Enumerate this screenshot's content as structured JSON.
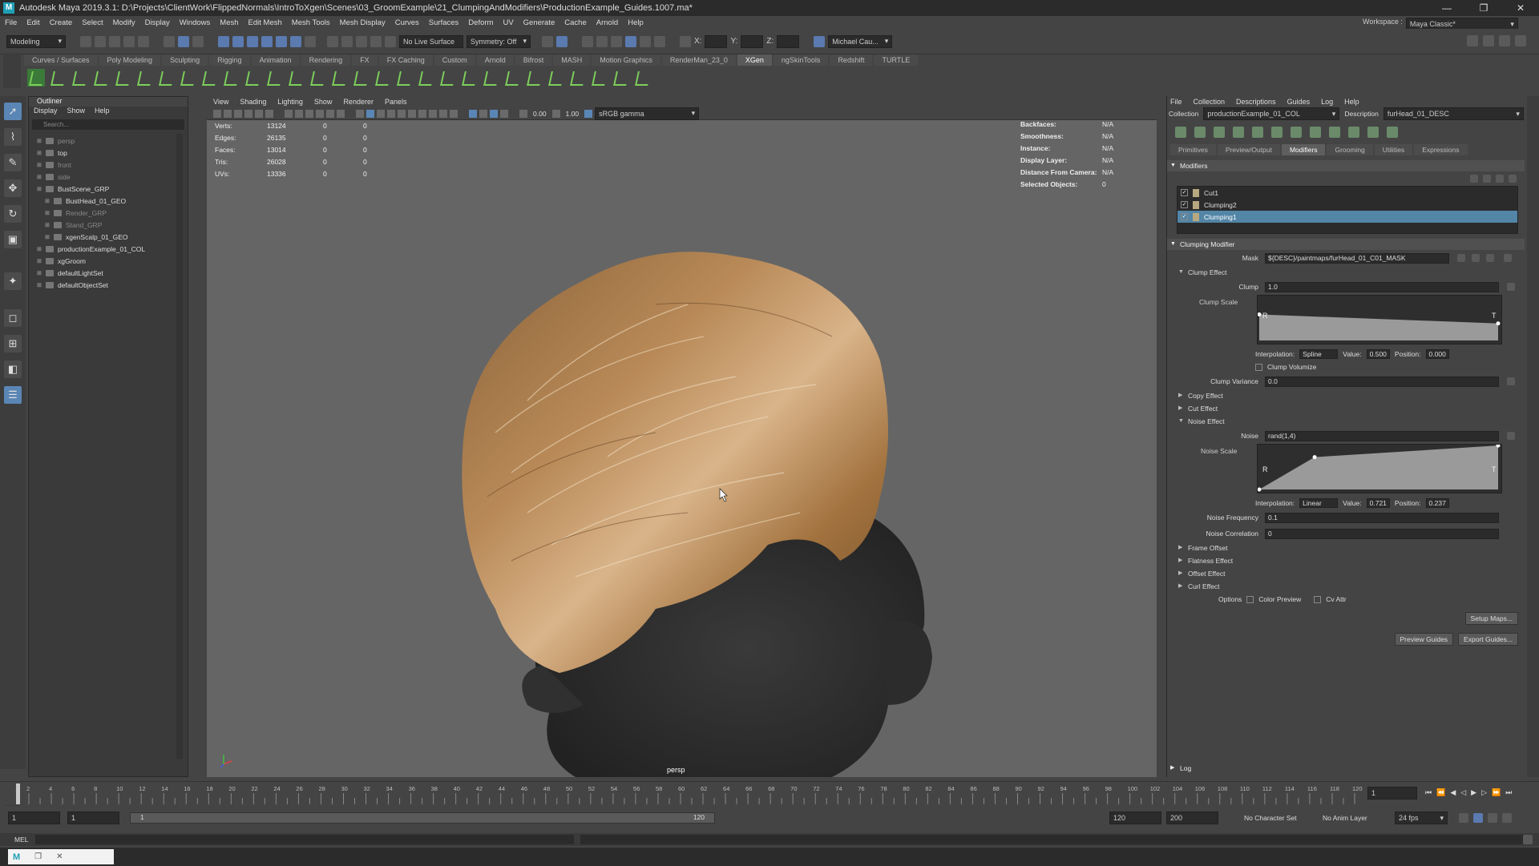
{
  "title_bar": {
    "title": "Autodesk Maya 2019.3.1: D:\\Projects\\ClientWork\\FlippedNormals\\IntroToXgen\\Scenes\\03_GroomExample\\21_ClumpingAndModifiers\\ProductionExample_Guides.1007.ma*",
    "minimize": "—",
    "maximize": "❐",
    "close": "✕"
  },
  "menu_bar": [
    "File",
    "Edit",
    "Create",
    "Select",
    "Modify",
    "Display",
    "Windows",
    "Mesh",
    "Edit Mesh",
    "Mesh Tools",
    "Mesh Display",
    "Curves",
    "Surfaces",
    "Deform",
    "UV",
    "Generate",
    "Cache",
    "Arnold",
    "Help"
  ],
  "workspace": {
    "label": "Workspace :",
    "value": "Maya Classic*"
  },
  "status_line": {
    "mode": "Modeling",
    "live_surface": "No Live Surface",
    "symmetry": "Symmetry: Off",
    "x": "X:",
    "y": "Y:",
    "z": "Z:",
    "user": "Michael Cau..."
  },
  "shelf_tabs": [
    "Curves / Surfaces",
    "Poly Modeling",
    "Sculpting",
    "Rigging",
    "Animation",
    "Rendering",
    "FX",
    "FX Caching",
    "Custom",
    "Arnold",
    "Bifrost",
    "MASH",
    "Motion Graphics",
    "RenderMan_23_0",
    "XGen",
    "ngSkinTools",
    "Redshift",
    "TURTLE"
  ],
  "shelf_active": "XGen",
  "outliner": {
    "title": "Outliner",
    "menu": [
      "Display",
      "Show",
      "Help"
    ],
    "search_placeholder": "Search...",
    "items": [
      {
        "label": "persp",
        "dim": true,
        "indent": 1
      },
      {
        "label": "top",
        "dim": false,
        "indent": 1
      },
      {
        "label": "front",
        "dim": true,
        "indent": 1
      },
      {
        "label": "side",
        "dim": true,
        "indent": 1
      },
      {
        "label": "BustScene_GRP",
        "dim": false,
        "indent": 1
      },
      {
        "label": "BustHead_01_GEO",
        "dim": false,
        "indent": 2
      },
      {
        "label": "Render_GRP",
        "dim": true,
        "indent": 2
      },
      {
        "label": "Stand_GRP",
        "dim": true,
        "indent": 2
      },
      {
        "label": "xgenScalp_01_GEO",
        "dim": false,
        "indent": 2
      },
      {
        "label": "productionExample_01_COL",
        "dim": false,
        "indent": 1
      },
      {
        "label": "xgGroom",
        "dim": false,
        "indent": 1
      },
      {
        "label": "defaultLightSet",
        "dim": false,
        "indent": 1
      },
      {
        "label": "defaultObjectSet",
        "dim": false,
        "indent": 1
      }
    ]
  },
  "viewport": {
    "menu": [
      "View",
      "Shading",
      "Lighting",
      "Show",
      "Renderer",
      "Panels"
    ],
    "exposure": "0.00",
    "gamma": "1.00",
    "color_space": "sRGB gamma",
    "camera_label": "persp",
    "hud_left": [
      {
        "k": "Verts:",
        "v1": "13124",
        "v2": "0",
        "v3": "0"
      },
      {
        "k": "Edges:",
        "v1": "26135",
        "v2": "0",
        "v3": "0"
      },
      {
        "k": "Faces:",
        "v1": "13014",
        "v2": "0",
        "v3": "0"
      },
      {
        "k": "Tris:",
        "v1": "26028",
        "v2": "0",
        "v3": "0"
      },
      {
        "k": "UVs:",
        "v1": "13336",
        "v2": "0",
        "v3": "0"
      }
    ],
    "hud_right": [
      {
        "k": "Backfaces:",
        "v": "N/A"
      },
      {
        "k": "Smoothness:",
        "v": "N/A"
      },
      {
        "k": "Instance:",
        "v": "N/A"
      },
      {
        "k": "Display Layer:",
        "v": "N/A"
      },
      {
        "k": "Distance From Camera:",
        "v": "N/A"
      },
      {
        "k": "Selected Objects:",
        "v": "0"
      }
    ]
  },
  "xgen": {
    "menu": [
      "File",
      "Collection",
      "Descriptions",
      "Guides",
      "Log",
      "Help"
    ],
    "collection_label": "Collection",
    "collection_value": "productionExample_01_COL",
    "description_label": "Description",
    "description_value": "furHead_01_DESC",
    "tabs": [
      "Primitives",
      "Preview/Output",
      "Modifiers",
      "Grooming",
      "Utilities",
      "Expressions"
    ],
    "active_tab": "Modifiers",
    "modifiers_header": "Modifiers",
    "modifiers": [
      {
        "label": "Cut1",
        "checked": true,
        "selected": false
      },
      {
        "label": "Clumping2",
        "checked": true,
        "selected": false
      },
      {
        "label": "Clumping1",
        "checked": true,
        "selected": true
      }
    ],
    "clumping_header": "Clumping Modifier",
    "mask_label": "Mask",
    "mask_value": "${DESC}/paintmaps/furHead_01_C01_MASK",
    "clump_effect": "Clump Effect",
    "clump_label": "Clump",
    "clump_value": "1.0",
    "clump_scale_label": "Clump Scale",
    "clump_scale_curve": {
      "start": 0.58,
      "end": 0.38
    },
    "interp_label": "Interpolation:",
    "interp1": "Spline",
    "value_label": "Value:",
    "value1": "0.500",
    "position_label": "Position:",
    "position1": "0.000",
    "clump_volumize": "Clump Volumize",
    "clump_variance_label": "Clump Variance",
    "clump_variance_value": "0.0",
    "copy_effect": "Copy Effect",
    "cut_effect": "Cut Effect",
    "noise_effect": "Noise Effect",
    "noise_label": "Noise",
    "noise_value": "rand(1,4)",
    "noise_scale_label": "Noise Scale",
    "noise_curve": {
      "key_value": 0.721,
      "key_position": 0.237
    },
    "interp2": "Linear",
    "value2": "0.721",
    "position2": "0.237",
    "noise_frequency_label": "Noise Frequency",
    "noise_frequency_value": "0.1",
    "noise_correlation_label": "Noise Correlation",
    "noise_correlation_value": "0",
    "frame_offset": "Frame Offset",
    "flatness_effect": "Flatness Effect",
    "offset_effect": "Offset Effect",
    "curl_effect": "Curl Effect",
    "options_label": "Options",
    "color_preview": "Color Preview",
    "cv_attr": "Cv Attr",
    "setup_maps": "Setup Maps...",
    "preview_guides": "Preview Guides",
    "export_guides": "Export Guides...",
    "log": "Log"
  },
  "timeline": {
    "ticks": [
      "1",
      "2",
      "4",
      "6",
      "8",
      "10",
      "12",
      "14",
      "16",
      "18",
      "20",
      "22",
      "24",
      "26",
      "28",
      "30",
      "32",
      "34",
      "36",
      "38",
      "40",
      "42",
      "44",
      "46",
      "48",
      "50",
      "52",
      "54",
      "56",
      "58",
      "60",
      "62",
      "64",
      "66",
      "68",
      "70",
      "72",
      "74",
      "76",
      "78",
      "80",
      "82",
      "84",
      "86",
      "88",
      "90",
      "92",
      "94",
      "96",
      "98",
      "100",
      "102",
      "104",
      "106",
      "108",
      "110",
      "112",
      "114",
      "116",
      "118",
      "120"
    ],
    "current_frame": "1"
  },
  "range": {
    "start": "1",
    "start2": "1",
    "slider_start": "1",
    "slider_end": "120",
    "end": "120",
    "end2": "200",
    "character_set": "No Character Set",
    "anim_layer": "No Anim Layer",
    "fps": "24 fps"
  },
  "mel_label": "MEL"
}
